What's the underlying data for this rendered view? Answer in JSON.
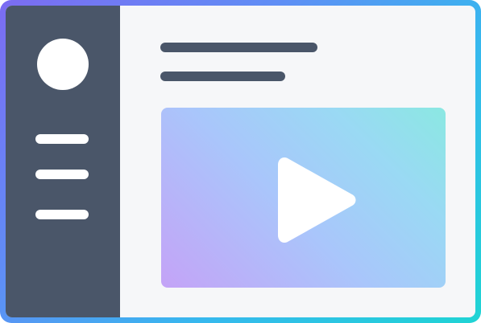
{
  "app": {
    "icon_set": {
      "avatar": "avatar-circle",
      "play": "play-icon"
    },
    "colors": {
      "frame_gradient": [
        "#7c6cf2",
        "#5f8ef5",
        "#36b8ee",
        "#1fd4d4"
      ],
      "sidebar": "#4a5669",
      "content_background": "#f6f7f9",
      "placeholder_lines": "#4a5669",
      "video_gradient": [
        "#c4a3f7",
        "#a9c6fb",
        "#9ad9f4",
        "#8be8e2"
      ],
      "play_icon": "#ffffff"
    }
  }
}
